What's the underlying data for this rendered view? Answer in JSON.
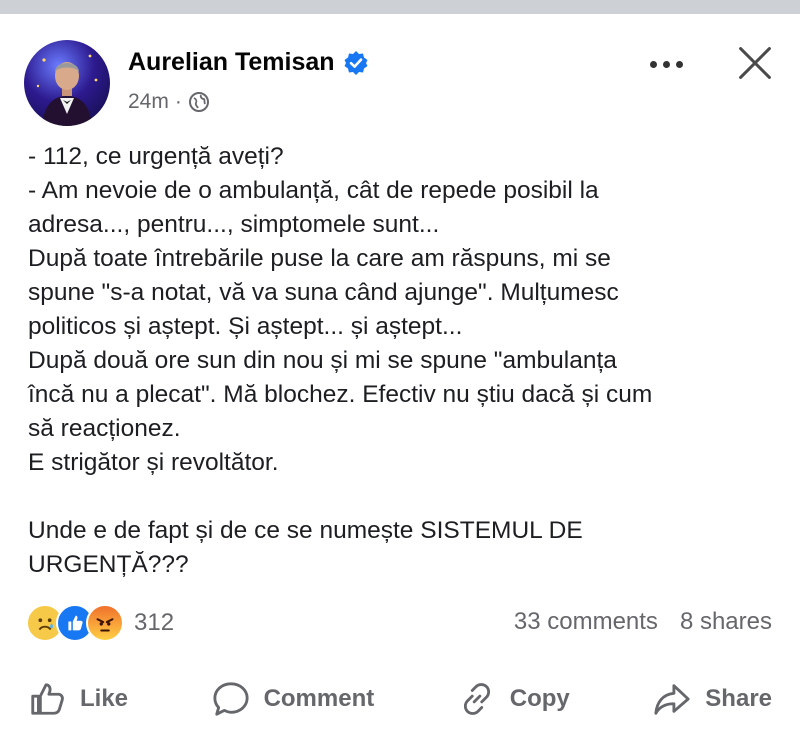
{
  "post": {
    "author": "Aurelian Temisan",
    "time": "24m",
    "separator": "·",
    "lines": [
      "- 112, ce urgență aveți?",
      "- Am nevoie de o ambulanță, cât de repede posibil la",
      "adresa..., pentru..., simptomele sunt...",
      "După toate întrebările puse la care am răspuns, mi se",
      "spune \"s-a notat, vă va suna când ajunge\". Mulțumesc",
      "politicos și aștept. Și aștept... și aștept...",
      "După două ore sun din nou și mi se spune \"ambulanța",
      "încă nu a plecat\". Mă blochez. Efectiv nu știu dacă și cum",
      "să reacționez.",
      "E strigător și revoltător.",
      "",
      "Unde e de fapt și de ce se numește SISTEMUL DE",
      "URGENȚĂ???"
    ]
  },
  "stats": {
    "reaction_count": "312",
    "comments": "33 comments",
    "shares": "8 shares",
    "reactions": [
      "sad-icon",
      "like-icon",
      "angry-icon"
    ]
  },
  "actions": {
    "like": "Like",
    "comment": "Comment",
    "copy": "Copy",
    "share": "Share"
  },
  "colors": {
    "verified": "#1877f2",
    "secondary_text": "#65676b",
    "top_strip": "#cdd0d4"
  }
}
